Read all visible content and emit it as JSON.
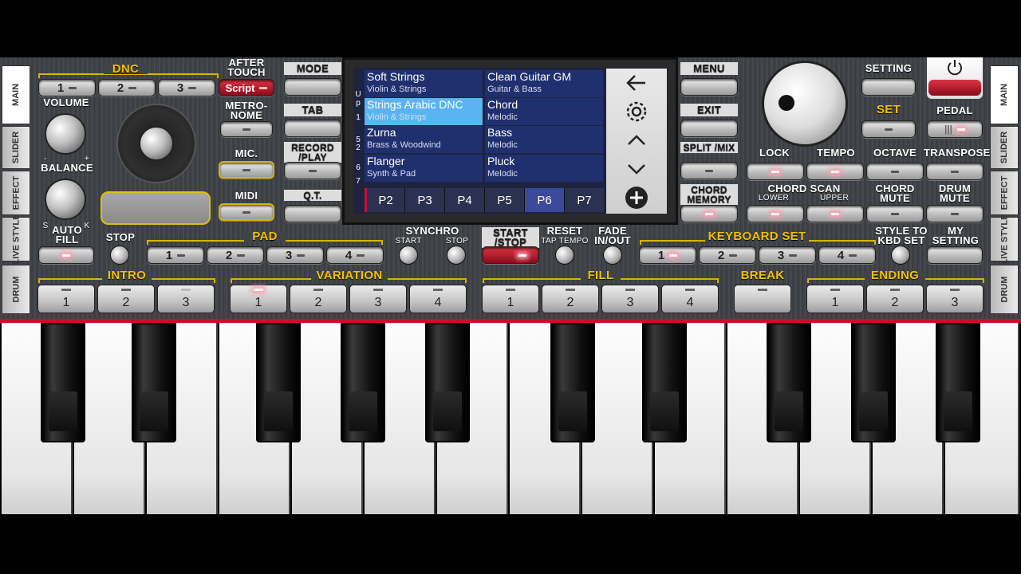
{
  "side_tabs_left": [
    "MAIN",
    "SLIDER",
    "EFFECT",
    "LIVE STYLE",
    "DRUM"
  ],
  "side_tabs_right": [
    "MAIN",
    "SLIDER",
    "EFFECT",
    "LIVE STYLE",
    "DRUM"
  ],
  "dnc": {
    "label": "DNC",
    "buttons": [
      "1",
      "2",
      "3"
    ],
    "script": "Script"
  },
  "after_touch": "AFTER TOUCH",
  "volume": "VOLUME",
  "balance": "BALANCE",
  "metronome": "METRO-NOME",
  "mic": "MIC.",
  "midi": "MIDI",
  "auto_fill": "AUTO FILL",
  "stop": "STOP",
  "pad": {
    "label": "PAD",
    "buttons": [
      "1",
      "2",
      "3",
      "4"
    ]
  },
  "synchro": {
    "label": "SYNCHRO",
    "start": "START",
    "stop": "STOP"
  },
  "start_stop": "START /STOP",
  "reset": "RESET",
  "tap_tempo": "TAP TEMPO",
  "fade": "FADE IN/OUT",
  "keyboard_set": {
    "label": "KEYBOARD SET",
    "buttons": [
      "1",
      "2",
      "3",
      "4"
    ]
  },
  "style_to_kbd": "STYLE TO KBD SET",
  "my_setting": "MY SETTING",
  "intro": {
    "label": "INTRO",
    "buttons": [
      "1",
      "2",
      "3"
    ]
  },
  "variation": {
    "label": "VARIATION",
    "buttons": [
      "1",
      "2",
      "3",
      "4"
    ]
  },
  "fill": {
    "label": "FILL",
    "buttons": [
      "1",
      "2",
      "3",
      "4"
    ]
  },
  "break": "BREAK",
  "ending": {
    "label": "ENDING",
    "buttons": [
      "1",
      "2",
      "3"
    ]
  },
  "left_menu": {
    "mode": "MODE",
    "tab": "TAB",
    "record": "RECORD /PLAY",
    "qt": "Q.T."
  },
  "right_menu": {
    "menu": "MENU",
    "exit": "EXIT",
    "split": "SPLIT /MIX",
    "chord_memory": "CHORD MEMORY"
  },
  "right_panel": {
    "setting": "SETTING",
    "set": "SET",
    "pedal": "PEDAL",
    "lock": "LOCK",
    "tempo": "TEMPO",
    "octave": "OCTAVE",
    "transpose": "TRANSPOSE",
    "chord_scan": "CHORD SCAN",
    "lower": "LOWER",
    "upper": "UPPER",
    "chord_mute": "CHORD MUTE",
    "drum_mute": "DRUM MUTE",
    "power_icon": "power-icon"
  },
  "sounds": [
    {
      "name": "Soft Strings",
      "category": "Violin & Strings"
    },
    {
      "name": "Clean Guitar GM",
      "category": "Guitar & Bass"
    },
    {
      "name": "Strings Arabic DNC",
      "category": "Violin & Strings"
    },
    {
      "name": "Chord",
      "category": "Melodic"
    },
    {
      "name": "Zurna",
      "category": "Brass & Woodwind"
    },
    {
      "name": "Bass",
      "category": "Melodic"
    },
    {
      "name": "Flanger",
      "category": "Synth & Pad"
    },
    {
      "name": "Pluck",
      "category": "Melodic"
    }
  ],
  "side_numbers": [
    "U",
    "p",
    "1",
    "5",
    "2",
    "6",
    "7"
  ],
  "pages": [
    "P2",
    "P3",
    "P4",
    "P5",
    "P6",
    "P7"
  ],
  "active_page": "P6",
  "nav_icons": [
    "back-arrow-icon",
    "gear-icon",
    "chevron-up-icon",
    "chevron-down-icon",
    "plus-circle-icon"
  ],
  "colors": {
    "accent_yellow": "#f2c200",
    "selected": "#5ab4f0",
    "cell": "#20306f",
    "red_stripe": "#c8102e"
  }
}
